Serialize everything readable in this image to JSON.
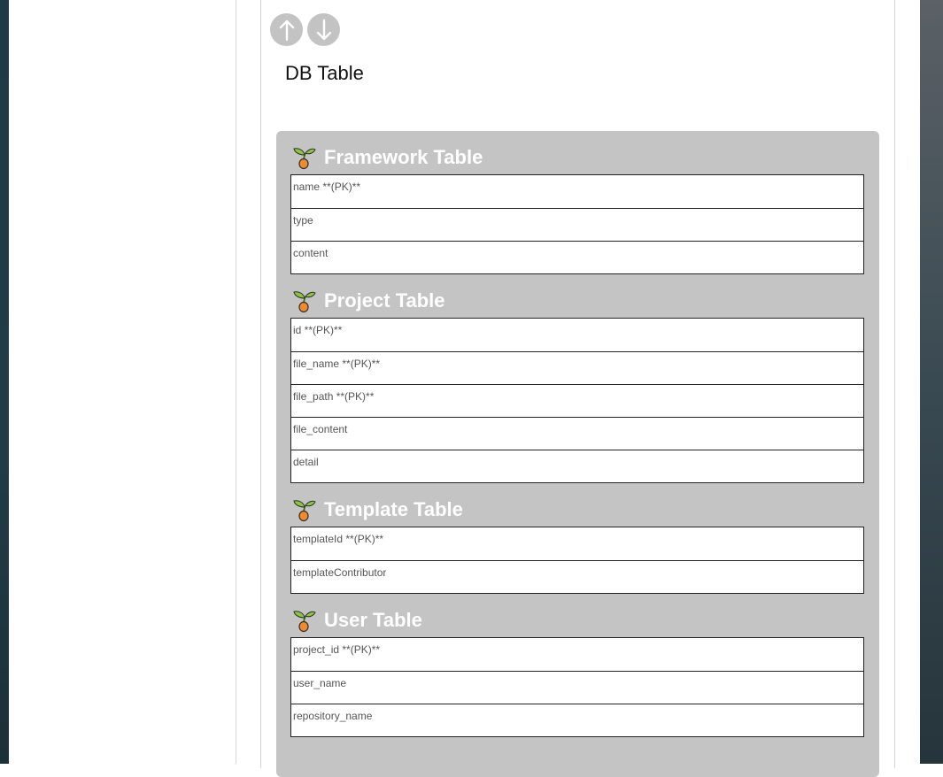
{
  "page": {
    "title": "DB Table",
    "move_up_icon": "arrow-up-icon",
    "move_down_icon": "arrow-down-icon"
  },
  "colors": {
    "panel_bg": "#c4c4c4",
    "button_bg": "#c3c3c3",
    "table_title": "#ffffff"
  },
  "tables": [
    {
      "title": "Framework Table",
      "icon": "sprout-icon",
      "fields": [
        "name **(PK)**",
        "type",
        "content"
      ]
    },
    {
      "title": "Project Table",
      "icon": "sprout-icon",
      "fields": [
        "id **(PK)**",
        "file_name **(PK)**",
        "file_path **(PK)**",
        "file_content",
        "detail"
      ]
    },
    {
      "title": "Template Table",
      "icon": "sprout-icon",
      "fields": [
        "templateId **(PK)**",
        "templateContributor"
      ]
    },
    {
      "title": "User Table",
      "icon": "sprout-icon",
      "fields": [
        "project_id **(PK)**",
        "user_name",
        "repository_name"
      ]
    }
  ]
}
